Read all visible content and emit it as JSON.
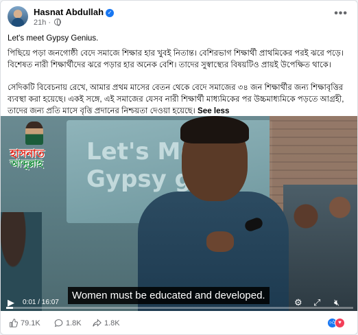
{
  "post": {
    "author": "Hasnat Abdullah",
    "time": "21h",
    "intro": "Let's meet Gypsy Genius.",
    "para1": "পিছিয়ে পড়া জনগোষ্ঠী বেদে সমাজে শিক্ষার হার খুবই নিতান্ত। বেশিরভাগ শিক্ষার্থী প্রাথমিকের পরই ঝরে পড়ে। বিশেষত নারী শিক্ষার্থীদের ঝরে পড়ার হার অনেক বেশি। তাদের সুস্বাস্থ্যের বিষয়টিও প্রায়ই উপেক্ষিত থাকে।",
    "para2": "সেদিকটি বিবেচনায় রেখে, আমার প্রথম মাসের বেতন থেকে বেদে সমাজের ৩৪ জন শিক্ষার্থীর জন্য শিক্ষাবৃত্তির ব্যবস্থা করা হয়েছে। একই সঙ্গে, এই সমাজের যেসব নারী শিক্ষার্থী মাধ্যমিকের পর উচ্চমাধ্যমিকে পড়তে আগ্রহী, তাদের জন্য প্রতি মাসে বৃত্তি প্রদানের নিশ্চয়তা দেওয়া হয়েছে।",
    "see_less": "See less"
  },
  "video": {
    "banner_text": "Let's Me\nGypsy gen",
    "logo_line1": "হাসনাত",
    "logo_line2": "আব্দুল্লাহ",
    "subtitle": "Women must be educated and developed.",
    "time": "0:01 / 16:07",
    "progress": 0.001
  },
  "footer": {
    "likes": "79.1K",
    "comments": "1.8K",
    "shares": "1.8K"
  },
  "colors": {
    "accent": "#1877f2",
    "love": "#f33e58",
    "muted": "#65676b"
  },
  "icons": [
    "verified-badge-icon",
    "globe-icon",
    "more-options-icon",
    "play-icon",
    "volume-icon",
    "settings-gear-icon",
    "fullscreen-icon",
    "mute-icon",
    "like-icon",
    "comment-icon",
    "share-icon"
  ]
}
